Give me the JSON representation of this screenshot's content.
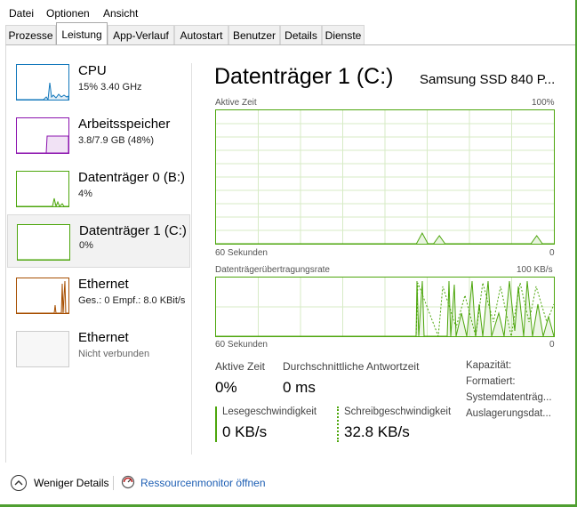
{
  "menu": [
    "Datei",
    "Optionen",
    "Ansicht"
  ],
  "tabs": [
    "Prozesse",
    "Leistung",
    "App-Verlauf",
    "Autostart",
    "Benutzer",
    "Details",
    "Dienste"
  ],
  "active_tab": "Leistung",
  "sidebar": {
    "items": [
      {
        "name": "CPU",
        "sub": "15%  3.40 GHz",
        "color": "#1177bb"
      },
      {
        "name": "Arbeitsspeicher",
        "sub": "3.8/7.9 GB (48%)",
        "color": "#8b12ae"
      },
      {
        "name": "Datenträger 0 (B:)",
        "sub": "4%",
        "color": "#4da60c"
      },
      {
        "name": "Datenträger 1 (C:)",
        "sub": "0%",
        "color": "#4da60c",
        "selected": true
      },
      {
        "name": "Ethernet",
        "sub": "Ges.: 0 Empf.: 8.0 KBit/s",
        "color": "#a74f01"
      },
      {
        "name": "Ethernet",
        "sub": "Nicht verbunden",
        "color": "#cccccc"
      }
    ]
  },
  "main": {
    "title": "Datenträger 1 (C:)",
    "model": "Samsung SSD 840 P...",
    "chart1": {
      "label": "Aktive Zeit",
      "max": "100%",
      "time": "60 Sekunden",
      "min": "0"
    },
    "chart2": {
      "label": "Datenträgerübertragungsrate",
      "max": "100 KB/s",
      "time": "60 Sekunden",
      "min": "0"
    },
    "stats": {
      "active_time_label": "Aktive Zeit",
      "active_time_value": "0%",
      "response_label": "Durchschnittliche Antwortzeit",
      "response_value": "0 ms",
      "read_label": "Lesegeschwindigkeit",
      "read_value": "0 KB/s",
      "write_label": "Schreibgeschwindigkeit",
      "write_value": "32.8 KB/s"
    },
    "properties": [
      "Kapazität:",
      "Formatiert:",
      "Systemdatenträg...",
      "Auslagerungsdat..."
    ]
  },
  "footer": {
    "less_details": "Weniger Details",
    "resource_monitor": "Ressourcenmonitor öffnen"
  },
  "colors": {
    "accent": "#4da60c",
    "link": "#1e5fb4"
  },
  "chart_data": {
    "type": "area",
    "title": "Aktive Zeit",
    "x": [
      60,
      0
    ],
    "ylim": [
      0,
      100
    ],
    "xlabel": "60 Sekunden",
    "series": [
      {
        "values": [
          0,
          0,
          0,
          0,
          0,
          0,
          0,
          0,
          0,
          0,
          0,
          0,
          0,
          0,
          0,
          0,
          0,
          0,
          0,
          0,
          0,
          0,
          0,
          0,
          0,
          0,
          0,
          0,
          0,
          0,
          0,
          0,
          0,
          0,
          0,
          0,
          8,
          0,
          0,
          6,
          0,
          0,
          0,
          0,
          0,
          0,
          0,
          0,
          0,
          0,
          0,
          0,
          0,
          0,
          0,
          0,
          6,
          0,
          0,
          0
        ]
      }
    ]
  }
}
